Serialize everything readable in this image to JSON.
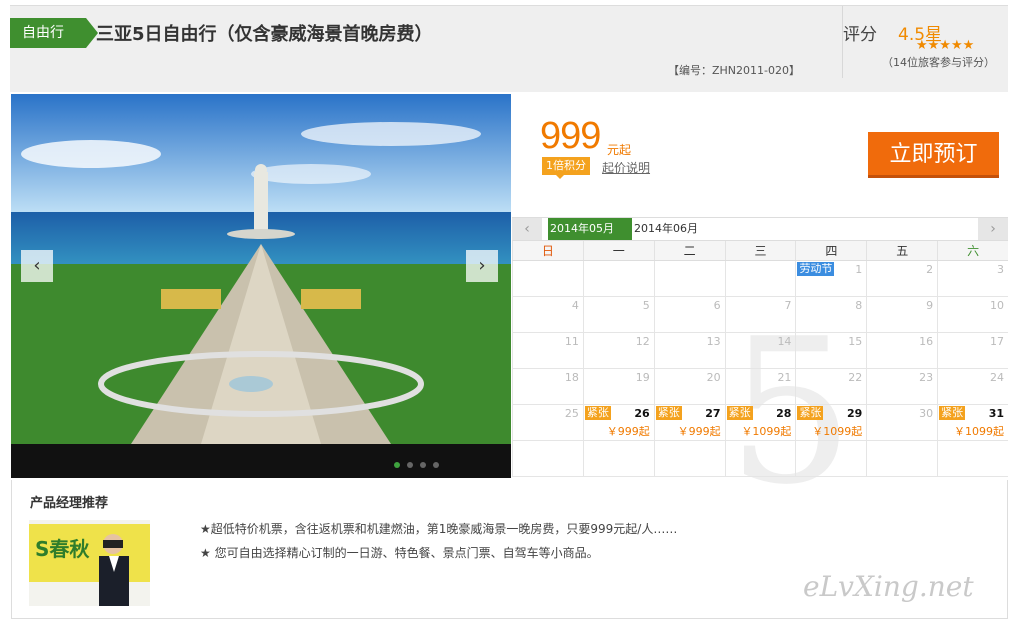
{
  "header": {
    "tag": "自由行",
    "title": "三亚5日自由行（仅含豪威海景首晚房费）",
    "code": "【编号：ZHN2011-020】",
    "rating_label": "评分",
    "rating_value": "4.5星",
    "stars": "★★★★★",
    "reviews": "（14位旅客参与评分）"
  },
  "gallery": {
    "prev_icon": "‹",
    "next_icon": "›",
    "dots": 4,
    "active_dot": 0
  },
  "pricing": {
    "price": "999",
    "unit": "元起",
    "points": "1倍积分",
    "note": "起价说明",
    "book_label": "立即预订"
  },
  "calendar": {
    "prev_icon": "‹",
    "next_icon": "›",
    "months": [
      "2014年05月",
      "2014年06月"
    ],
    "big_digit": "5",
    "weekdays": [
      "日",
      "一",
      "二",
      "三",
      "四",
      "五",
      "六"
    ],
    "rows": [
      [
        {
          "d": ""
        },
        {
          "d": ""
        },
        {
          "d": ""
        },
        {
          "d": ""
        },
        {
          "d": "1",
          "holiday": "劳动节"
        },
        {
          "d": "2"
        },
        {
          "d": "3"
        }
      ],
      [
        {
          "d": "4"
        },
        {
          "d": "5"
        },
        {
          "d": "6"
        },
        {
          "d": "7"
        },
        {
          "d": "8"
        },
        {
          "d": "9"
        },
        {
          "d": "10"
        }
      ],
      [
        {
          "d": "11"
        },
        {
          "d": "12"
        },
        {
          "d": "13"
        },
        {
          "d": "14"
        },
        {
          "d": "15"
        },
        {
          "d": "16"
        },
        {
          "d": "17"
        }
      ],
      [
        {
          "d": "18"
        },
        {
          "d": "19"
        },
        {
          "d": "20"
        },
        {
          "d": "21"
        },
        {
          "d": "22"
        },
        {
          "d": "23"
        },
        {
          "d": "24"
        }
      ],
      [
        {
          "d": "25"
        },
        {
          "d": "26",
          "tag": "紧张",
          "price": "￥999起"
        },
        {
          "d": "27",
          "tag": "紧张",
          "price": "￥999起"
        },
        {
          "d": "28",
          "tag": "紧张",
          "price": "￥1099起"
        },
        {
          "d": "29",
          "tag": "紧张",
          "price": "￥1099起"
        },
        {
          "d": "30"
        },
        {
          "d": "31",
          "tag": "紧张",
          "price": "￥1099起"
        }
      ],
      [
        {
          "d": ""
        },
        {
          "d": ""
        },
        {
          "d": ""
        },
        {
          "d": ""
        },
        {
          "d": ""
        },
        {
          "d": ""
        },
        {
          "d": ""
        }
      ]
    ]
  },
  "recommend": {
    "title": "产品经理推荐",
    "photo_banner_text": "S春秋",
    "line1": "★超低特价机票，含往返机票和机建燃油，第1晚豪威海景一晚房费，只要999元起/人……",
    "line2": "★ 您可自由选择精心订制的一日游、特色餐、景点门票、自驾车等小商品。"
  },
  "watermark": "eLvXing.net",
  "colors": {
    "brand_green": "#3f8f2f",
    "accent_orange": "#f07a00",
    "button_orange": "#f06b0c",
    "holiday_blue": "#3b8de0"
  }
}
